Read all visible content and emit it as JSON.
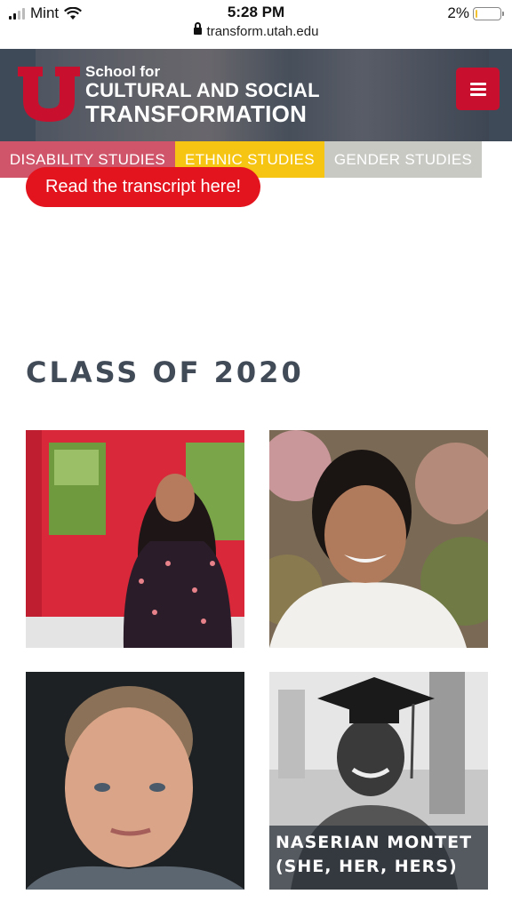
{
  "status_bar": {
    "carrier": "Mint",
    "time": "5:28 PM",
    "battery_percent": "2%",
    "battery_level": 0.02
  },
  "browser": {
    "url": "transform.utah.edu"
  },
  "header": {
    "logo_line1": "School for",
    "logo_line2": "CULTURAL AND SOCIAL",
    "logo_line3": "TRANSFORMATION",
    "menu_icon": "hamburger-menu-icon"
  },
  "tabs": [
    {
      "label": "DISABILITY STUDIES",
      "color": "#be1432"
    },
    {
      "label": "ETHNIC STUDIES",
      "color": "#f6c413"
    },
    {
      "label": "GENDER STUDIES",
      "color": "#c9c9c4"
    }
  ],
  "transcript_button": "Read the transcript here!",
  "section_title": "CLASS OF 2020",
  "cards": [
    {
      "caption": ""
    },
    {
      "caption": ""
    },
    {
      "caption": ""
    },
    {
      "caption": "NASERIAN MONTET (SHE, HER, HERS)"
    }
  ],
  "colors": {
    "brand_red": "#c8102e",
    "header_bg": "#3f4a58",
    "title_text": "#414a57"
  }
}
